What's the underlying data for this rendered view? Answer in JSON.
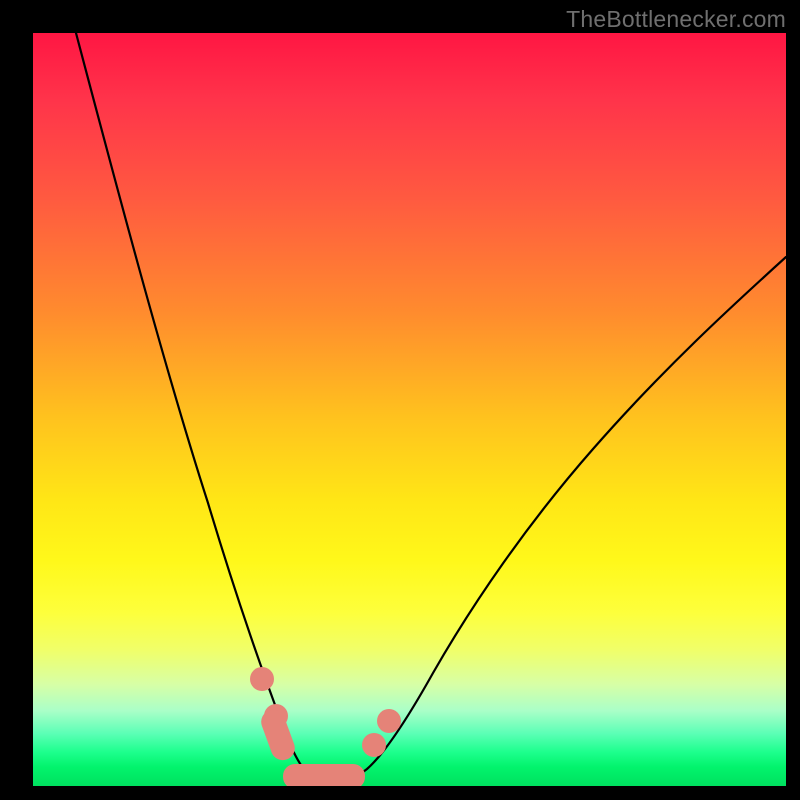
{
  "watermark": "TheBottlenecker.com",
  "colors": {
    "background": "#000000",
    "gradient_top": "#ff1643",
    "gradient_bottom": "#00e15f",
    "curve": "#000000",
    "bead": "#e58378"
  },
  "chart_data": {
    "type": "line",
    "title": "",
    "xlabel": "",
    "ylabel": "",
    "xlim": [
      0,
      1
    ],
    "ylim": [
      0,
      1
    ],
    "series": [
      {
        "name": "left-branch",
        "x": [
          0.057,
          0.09,
          0.13,
          0.17,
          0.21,
          0.245,
          0.28,
          0.305,
          0.33,
          0.345
        ],
        "y": [
          1.0,
          0.86,
          0.7,
          0.54,
          0.38,
          0.24,
          0.13,
          0.06,
          0.025,
          0.01
        ]
      },
      {
        "name": "floor",
        "x": [
          0.345,
          0.42
        ],
        "y": [
          0.01,
          0.01
        ]
      },
      {
        "name": "right-branch",
        "x": [
          0.42,
          0.46,
          0.51,
          0.58,
          0.66,
          0.75,
          0.86,
          0.985
        ],
        "y": [
          0.01,
          0.045,
          0.11,
          0.21,
          0.33,
          0.45,
          0.57,
          0.7
        ]
      }
    ],
    "markers": [
      {
        "name": "left-bead-1",
        "x": 0.304,
        "y": 0.082
      },
      {
        "name": "left-bead-2",
        "x": 0.322,
        "y": 0.045
      },
      {
        "name": "right-bead-1",
        "x": 0.452,
        "y": 0.055
      },
      {
        "name": "right-bead-2",
        "x": 0.47,
        "y": 0.082
      }
    ],
    "floor_bar": {
      "x0": 0.332,
      "x1": 0.44,
      "y": 0.013,
      "thickness": 0.035
    }
  }
}
